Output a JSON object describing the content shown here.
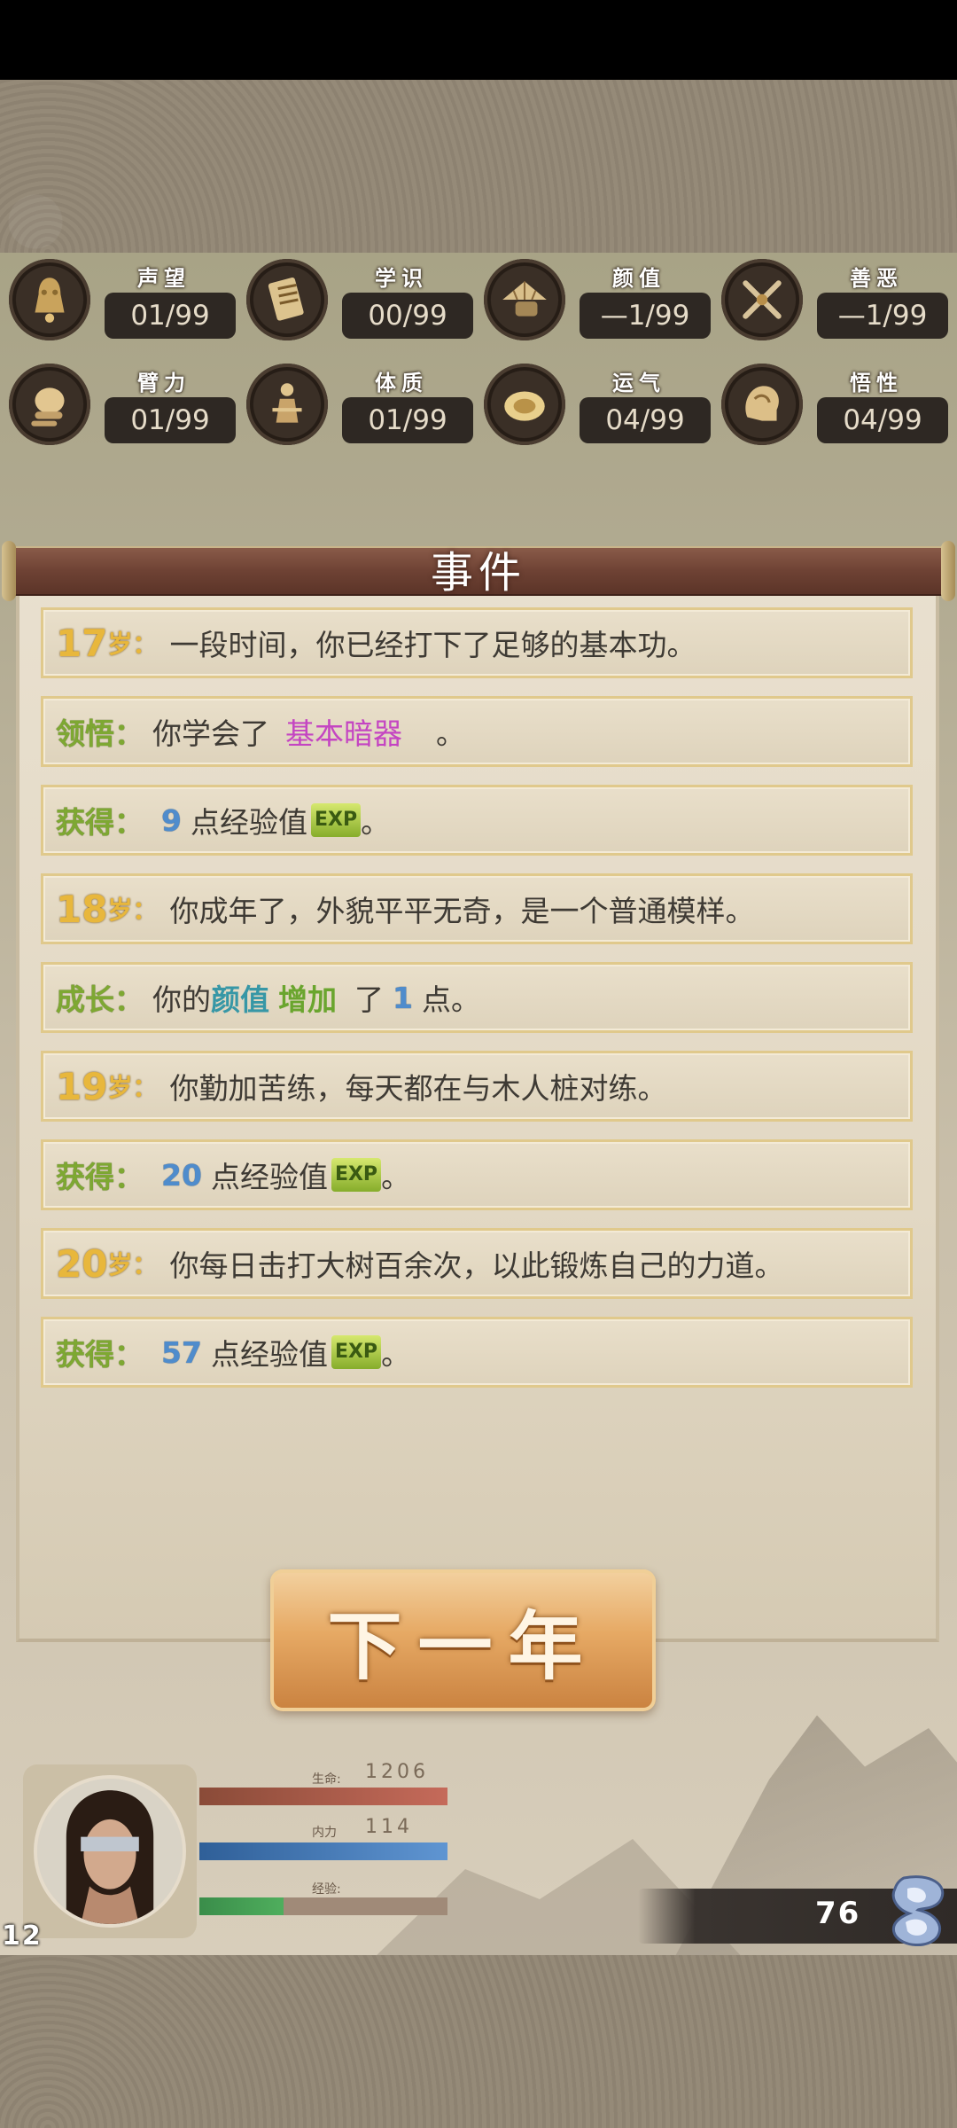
{
  "attributes": [
    {
      "label": "声望",
      "value": "01/99",
      "icon": "bell-icon"
    },
    {
      "label": "学识",
      "value": "00/99",
      "icon": "scroll-icon"
    },
    {
      "label": "颜值",
      "value": "—1/99",
      "icon": "hat-icon"
    },
    {
      "label": "善恶",
      "value": "—1/99",
      "icon": "crossed-swords-icon"
    },
    {
      "label": "臂力",
      "value": "01/99",
      "icon": "fist-icon"
    },
    {
      "label": "体质",
      "value": "01/99",
      "icon": "body-icon"
    },
    {
      "label": "运气",
      "value": "04/99",
      "icon": "coin-icon"
    },
    {
      "label": "悟性",
      "value": "04/99",
      "icon": "mind-icon"
    }
  ],
  "panel": {
    "title": "事件"
  },
  "events": [
    {
      "age": "17",
      "age_unit": "岁：",
      "text": "一段时间，你已经打下了足够的基本功。"
    },
    {
      "tag": "领悟：",
      "text": "你学会了",
      "highlight": "基本暗器",
      "suffix": "。"
    },
    {
      "tag": "获得：",
      "num": "9",
      "text": "点经验值",
      "exp": "EXP",
      "suffix": "。"
    },
    {
      "age": "18",
      "age_unit": "岁：",
      "text": "你成年了，外貌平平无奇，是一个普通模样。"
    },
    {
      "tag": "成长：",
      "text": "你的",
      "attr": "颜值",
      "verb": "增加",
      "text2": "了",
      "num": "1",
      "suffix": "点。"
    },
    {
      "age": "19",
      "age_unit": "岁：",
      "text": "你勤加苦练，每天都在与木人桩对练。"
    },
    {
      "tag": "获得：",
      "num": "20",
      "text": "点经验值",
      "exp": "EXP",
      "suffix": "。"
    },
    {
      "age": "20",
      "age_unit": "岁：",
      "text": "你每日击打大树百余次，以此锻炼自己的力道。"
    },
    {
      "tag": "获得：",
      "num": "57",
      "text": "点经验值",
      "exp": "EXP",
      "suffix": "。"
    }
  ],
  "next_button": {
    "label": "下一年"
  },
  "player": {
    "level": "12",
    "hp_label": "生命:",
    "hp_value": "1206",
    "hp_fraction": 1.0,
    "mp_label": "内力",
    "mp_value": "114",
    "mp_fraction": 1.0,
    "xp_label": "经验:",
    "xp_fraction": 0.34
  },
  "currency": {
    "value": "76",
    "icon": "silver-ingot-icon"
  }
}
